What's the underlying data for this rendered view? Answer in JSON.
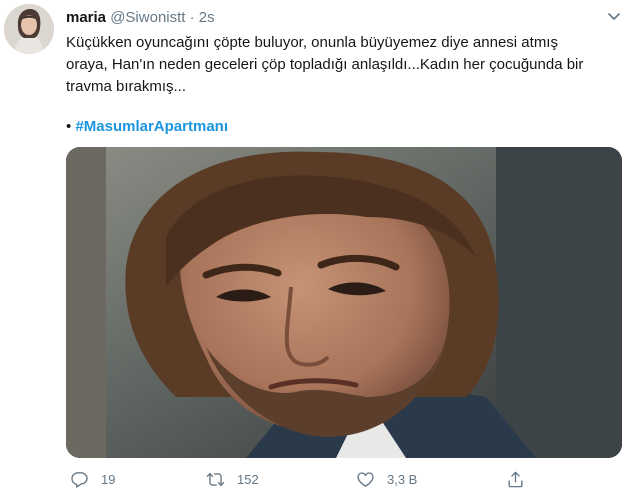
{
  "tweet": {
    "author_name": "maria",
    "handle": "@Siwonistt",
    "separator": "·",
    "time": "2s",
    "text_lines": [
      "Küçükken oyuncağını çöpte buluyor, onunla büyüyemez diye annesi atmış",
      "oraya, Han'ın neden geceleri çöp topladığı anlaşıldı...Kadın her çocuğunda bir",
      "travma bırakmış..."
    ],
    "bullet": "•",
    "hashtag": "#MasumlarApartmanı"
  },
  "actions": {
    "reply_count": "19",
    "retweet_count": "152",
    "like_count": "3,3 B"
  },
  "icons": {
    "caret": "chevron-down-icon",
    "reply": "reply-icon",
    "retweet": "retweet-icon",
    "like": "heart-icon",
    "share": "share-icon"
  },
  "colors": {
    "link": "#1b95e0",
    "secondary_text": "#657786",
    "primary_text": "#14171a"
  }
}
